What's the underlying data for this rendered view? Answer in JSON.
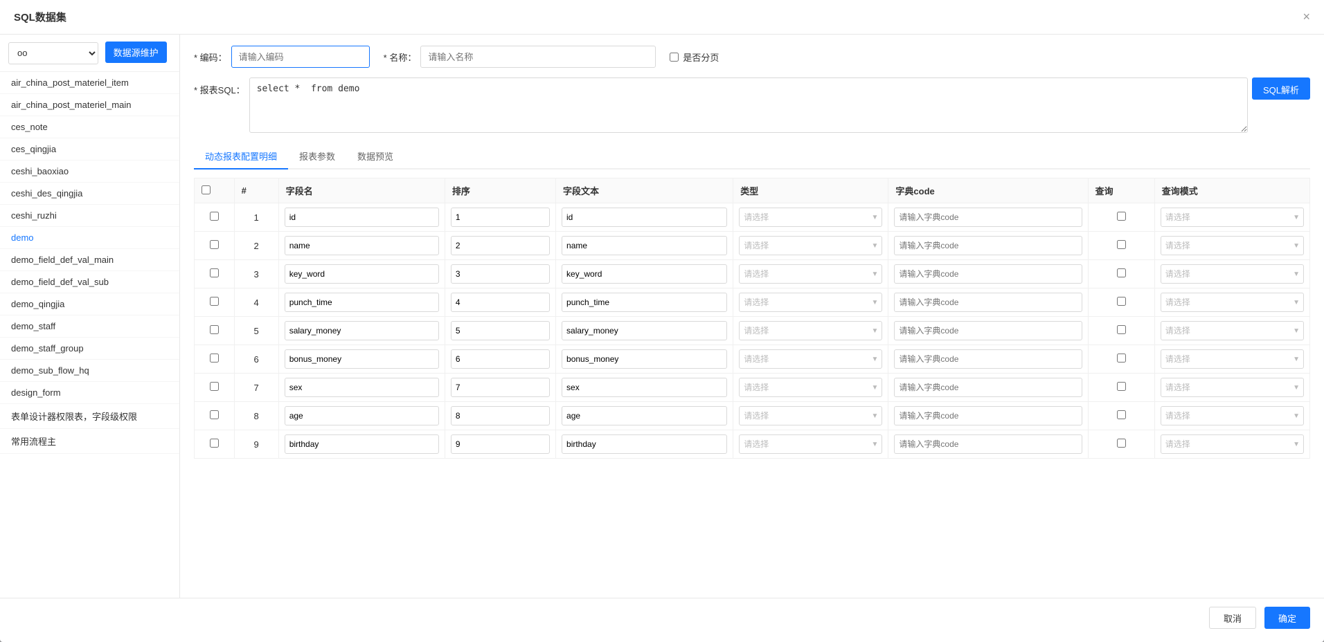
{
  "modal": {
    "title": "SQL数据集",
    "close_label": "×"
  },
  "form": {
    "code_label": "* 编码：",
    "code_placeholder": "请输入编码",
    "name_label": "* 名称：",
    "name_placeholder": "请输入名称",
    "pagination_label": "是否分页",
    "sql_label": "* 报表SQL：",
    "sql_value": "select *  from demo",
    "sql_btn": "SQL解析"
  },
  "sidebar": {
    "select_value": "oo",
    "btn_label": "数据源维护",
    "items": [
      {
        "label": "air_china_post_materiel_item",
        "active": false
      },
      {
        "label": "air_china_post_materiel_main",
        "active": false
      },
      {
        "label": "ces_note",
        "active": false
      },
      {
        "label": "ces_qingjia",
        "active": false
      },
      {
        "label": "ceshi_baoxiao",
        "active": false
      },
      {
        "label": "ceshi_des_qingjia",
        "active": false
      },
      {
        "label": "ceshi_ruzhi",
        "active": false
      },
      {
        "label": "demo",
        "active": true
      },
      {
        "label": "demo_field_def_val_main",
        "active": false
      },
      {
        "label": "demo_field_def_val_sub",
        "active": false
      },
      {
        "label": "demo_qingjia",
        "active": false
      },
      {
        "label": "demo_staff",
        "active": false
      },
      {
        "label": "demo_staff_group",
        "active": false
      },
      {
        "label": "demo_sub_flow_hq",
        "active": false
      },
      {
        "label": "design_form",
        "active": false
      },
      {
        "label": "表单设计器权限表，字段级权限",
        "active": false
      },
      {
        "label": "常用流程主",
        "active": false
      }
    ]
  },
  "tabs": [
    {
      "label": "动态报表配置明细",
      "active": true
    },
    {
      "label": "报表参数",
      "active": false
    },
    {
      "label": "数据预览",
      "active": false
    }
  ],
  "table": {
    "headers": [
      "#",
      "字段名",
      "排序",
      "字段文本",
      "类型",
      "字典code",
      "查询",
      "查询模式"
    ],
    "type_placeholder": "请选择",
    "dict_placeholder": "请输入字典code",
    "query_mode_placeholder": "请选择",
    "rows": [
      {
        "num": 1,
        "field": "id",
        "sort": "1",
        "text": "id"
      },
      {
        "num": 2,
        "field": "name",
        "sort": "2",
        "text": "name"
      },
      {
        "num": 3,
        "field": "key_word",
        "sort": "3",
        "text": "key_word"
      },
      {
        "num": 4,
        "field": "punch_time",
        "sort": "4",
        "text": "punch_time"
      },
      {
        "num": 5,
        "field": "salary_money",
        "sort": "5",
        "text": "salary_money"
      },
      {
        "num": 6,
        "field": "bonus_money",
        "sort": "6",
        "text": "bonus_money"
      },
      {
        "num": 7,
        "field": "sex",
        "sort": "7",
        "text": "sex"
      },
      {
        "num": 8,
        "field": "age",
        "sort": "8",
        "text": "age"
      },
      {
        "num": 9,
        "field": "birthday",
        "sort": "9",
        "text": "birthday"
      }
    ]
  },
  "footer": {
    "cancel_label": "取消",
    "confirm_label": "确定"
  }
}
